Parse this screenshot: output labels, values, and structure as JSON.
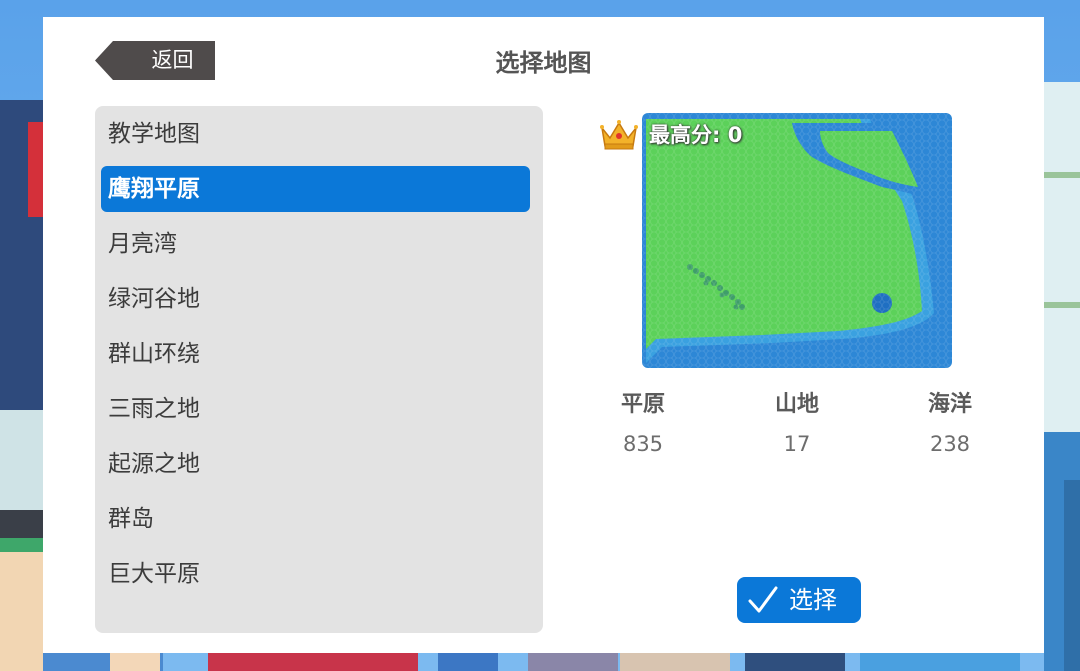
{
  "header": {
    "back_label": "返回",
    "title": "选择地图"
  },
  "map_list": {
    "items": [
      {
        "label": "教学地图",
        "selected": false
      },
      {
        "label": "鹰翔平原",
        "selected": true
      },
      {
        "label": "月亮湾",
        "selected": false
      },
      {
        "label": "绿河谷地",
        "selected": false
      },
      {
        "label": "群山环绕",
        "selected": false
      },
      {
        "label": "三雨之地",
        "selected": false
      },
      {
        "label": "起源之地",
        "selected": false
      },
      {
        "label": "群岛",
        "selected": false
      },
      {
        "label": "巨大平原",
        "selected": false
      }
    ]
  },
  "preview": {
    "best_score_text": "最高分: 0",
    "icons": {
      "crown": "crown-icon"
    }
  },
  "stats": {
    "plains": {
      "label": "平原",
      "value": "835"
    },
    "mountains": {
      "label": "山地",
      "value": "17"
    },
    "ocean": {
      "label": "海洋",
      "value": "238"
    }
  },
  "actions": {
    "select_label": "选择",
    "select_icon": "checkmark-icon"
  },
  "colors": {
    "accent": "#0b78d8",
    "land": "#5cd15a",
    "water": "#2d87d6",
    "deep_water": "#1f6fc2"
  }
}
